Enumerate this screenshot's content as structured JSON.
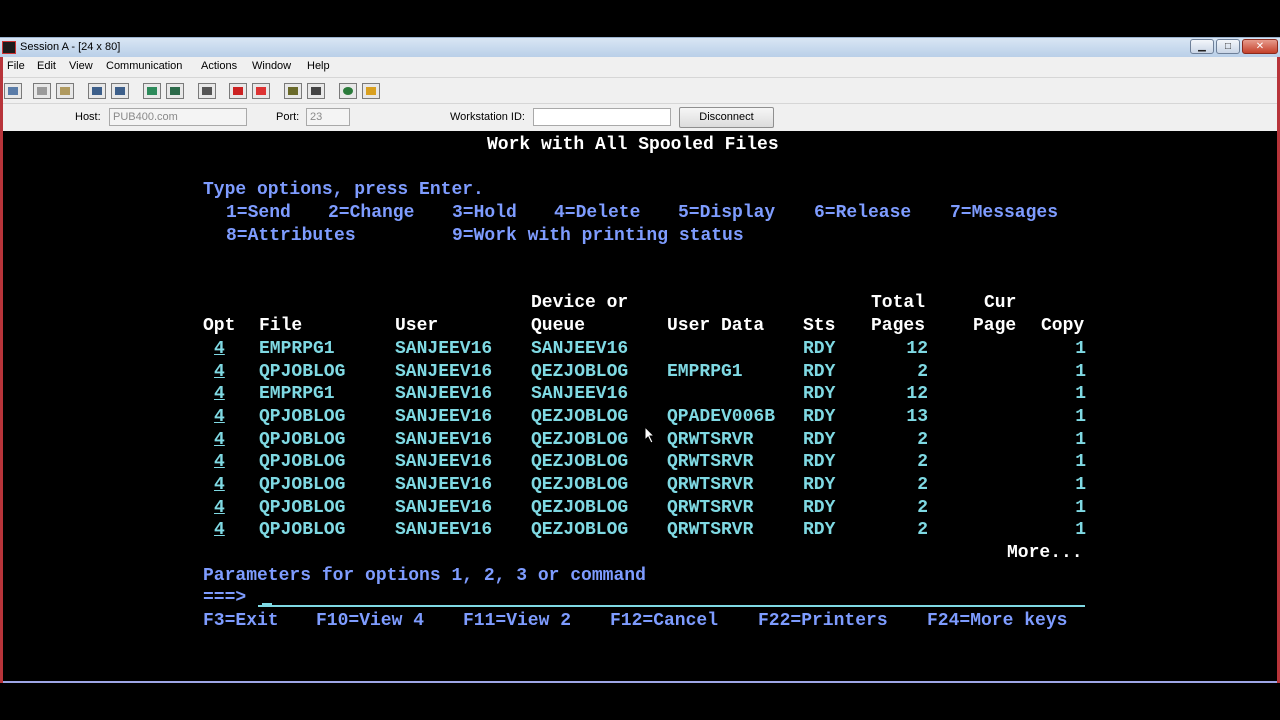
{
  "window": {
    "title": "Session A - [24 x 80]",
    "min_glyph": "▁",
    "max_glyph": "□",
    "close_glyph": "✕"
  },
  "menu": [
    "File",
    "Edit",
    "View",
    "Communication",
    "Actions",
    "Window",
    "Help"
  ],
  "toolbar": {
    "icons": [
      "print-screen-icon",
      "copy-icon",
      "paste-icon",
      "send-file-icon",
      "receive-file-icon",
      "display-icon",
      "macro-icon",
      "keypad-icon",
      "record-macro-icon",
      "stop-macro-icon",
      "play-macro-icon",
      "run-macro-icon",
      "globe-icon",
      "customize-icon"
    ]
  },
  "connection": {
    "host_label": "Host:",
    "host_value": "PUB400.com",
    "port_label": "Port:",
    "port_value": "23",
    "workstation_label": "Workstation ID:",
    "workstation_value": "",
    "disconnect_label": "Disconnect"
  },
  "terminal": {
    "screen_title": "Work with All Spooled Files",
    "instructions": "Type options, press Enter.",
    "options_line1": [
      "1=Send",
      "2=Change",
      "3=Hold",
      "4=Delete",
      "5=Display",
      "6=Release",
      "7=Messages"
    ],
    "options_line2": [
      "8=Attributes",
      "9=Work with printing status"
    ],
    "headers": {
      "opt": "Opt",
      "file": "File",
      "user": "User",
      "device_top": "Device or",
      "device": "Queue",
      "user_data": "User Data",
      "sts": "Sts",
      "total_top": "Total",
      "total": "Pages",
      "cur_top": "Cur",
      "cur": "Page",
      "copy": "Copy"
    },
    "rows": [
      {
        "opt": "4",
        "file": "EMPRPG1",
        "user": "SANJEEV16",
        "queue": "SANJEEV16",
        "user_data": "",
        "sts": "RDY",
        "pages": "12",
        "cur_page": "",
        "copy": "1"
      },
      {
        "opt": "4",
        "file": "QPJOBLOG",
        "user": "SANJEEV16",
        "queue": "QEZJOBLOG",
        "user_data": "EMPRPG1",
        "sts": "RDY",
        "pages": "2",
        "cur_page": "",
        "copy": "1"
      },
      {
        "opt": "4",
        "file": "EMPRPG1",
        "user": "SANJEEV16",
        "queue": "SANJEEV16",
        "user_data": "",
        "sts": "RDY",
        "pages": "12",
        "cur_page": "",
        "copy": "1"
      },
      {
        "opt": "4",
        "file": "QPJOBLOG",
        "user": "SANJEEV16",
        "queue": "QEZJOBLOG",
        "user_data": "QPADEV006B",
        "sts": "RDY",
        "pages": "13",
        "cur_page": "",
        "copy": "1"
      },
      {
        "opt": "4",
        "file": "QPJOBLOG",
        "user": "SANJEEV16",
        "queue": "QEZJOBLOG",
        "user_data": "QRWTSRVR",
        "sts": "RDY",
        "pages": "2",
        "cur_page": "",
        "copy": "1"
      },
      {
        "opt": "4",
        "file": "QPJOBLOG",
        "user": "SANJEEV16",
        "queue": "QEZJOBLOG",
        "user_data": "QRWTSRVR",
        "sts": "RDY",
        "pages": "2",
        "cur_page": "",
        "copy": "1"
      },
      {
        "opt": "4",
        "file": "QPJOBLOG",
        "user": "SANJEEV16",
        "queue": "QEZJOBLOG",
        "user_data": "QRWTSRVR",
        "sts": "RDY",
        "pages": "2",
        "cur_page": "",
        "copy": "1"
      },
      {
        "opt": "4",
        "file": "QPJOBLOG",
        "user": "SANJEEV16",
        "queue": "QEZJOBLOG",
        "user_data": "QRWTSRVR",
        "sts": "RDY",
        "pages": "2",
        "cur_page": "",
        "copy": "1"
      },
      {
        "opt": "4",
        "file": "QPJOBLOG",
        "user": "SANJEEV16",
        "queue": "QEZJOBLOG",
        "user_data": "QRWTSRVR",
        "sts": "RDY",
        "pages": "2",
        "cur_page": "",
        "copy": "1"
      }
    ],
    "more": "More...",
    "params_label": "Parameters for options 1, 2, 3 or command",
    "prompt": "===>",
    "command_value": "",
    "fkeys": [
      "F3=Exit",
      "F10=View 4",
      "F11=View 2",
      "F12=Cancel",
      "F22=Printers",
      "F24=More keys"
    ]
  },
  "colors": {
    "text_turquoise": "#7fd9e3",
    "text_white": "#ffffff",
    "text_blue": "#7e9cff",
    "screen_bg": "#000000",
    "window_border": "#b8343a"
  }
}
